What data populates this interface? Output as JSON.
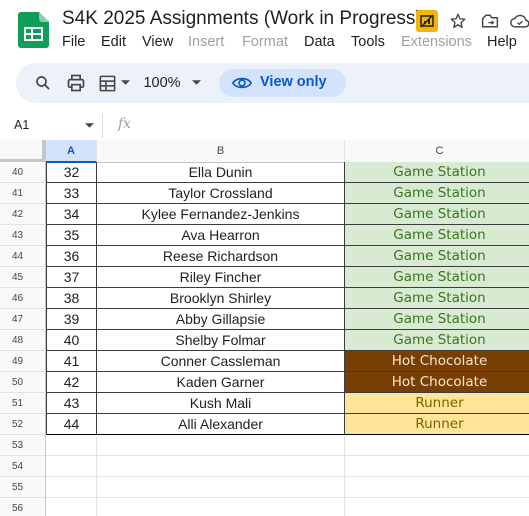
{
  "app": {
    "title": "S4K 2025 Assignments (Work in Progress)",
    "icons": [
      "sheets-logo-icon",
      "shared-drive-icon",
      "star-icon",
      "move-icon",
      "cloud-status-icon"
    ]
  },
  "menu": [
    "File",
    "Edit",
    "View",
    "Insert",
    "Format",
    "Data",
    "Tools",
    "Extensions",
    "Help"
  ],
  "menu_disabled": [
    "Insert",
    "Format",
    "Extensions"
  ],
  "toolbar": {
    "zoom": "100%",
    "view_only_label": "View only",
    "icons": [
      "search-icon",
      "print-icon",
      "format-menu-icon",
      "dropdown-icon",
      "eye-icon"
    ]
  },
  "formula_bar": {
    "name_box": "A1",
    "fx": "fx"
  },
  "columns": [
    "A",
    "B",
    "C"
  ],
  "selected_column": "A",
  "colors": {
    "game_station_bg": "#d9ead3",
    "game_station_text": "#38761d",
    "hot_chocolate_bg": "#783f04",
    "hot_chocolate_text": "#fce5cd",
    "runner_bg": "#ffe599",
    "runner_text": "#7f6000"
  },
  "rows": [
    {
      "row": "40",
      "num": "32",
      "name": "Ella Dunin",
      "role": "Game Station",
      "kind": "game"
    },
    {
      "row": "41",
      "num": "33",
      "name": "Taylor Crossland",
      "role": "Game Station",
      "kind": "game"
    },
    {
      "row": "42",
      "num": "34",
      "name": "Kylee Fernandez-Jenkins",
      "role": "Game Station",
      "kind": "game"
    },
    {
      "row": "43",
      "num": "35",
      "name": "Ava Hearron",
      "role": "Game Station",
      "kind": "game"
    },
    {
      "row": "44",
      "num": "36",
      "name": "Reese Richardson",
      "role": "Game Station",
      "kind": "game"
    },
    {
      "row": "45",
      "num": "37",
      "name": "Riley Fincher",
      "role": "Game Station",
      "kind": "game"
    },
    {
      "row": "46",
      "num": "38",
      "name": "Brooklyn Shirley",
      "role": "Game Station",
      "kind": "game"
    },
    {
      "row": "47",
      "num": "39",
      "name": "Abby Gillapsie",
      "role": "Game Station",
      "kind": "game"
    },
    {
      "row": "48",
      "num": "40",
      "name": "Shelby Folmar",
      "role": "Game Station",
      "kind": "game"
    },
    {
      "row": "49",
      "num": "41",
      "name": "Conner Cassleman",
      "role": "Hot Chocolate",
      "kind": "cocoa"
    },
    {
      "row": "50",
      "num": "42",
      "name": "Kaden Garner",
      "role": "Hot Chocolate",
      "kind": "cocoa"
    },
    {
      "row": "51",
      "num": "43",
      "name": "Kush Mali",
      "role": "Runner",
      "kind": "runner"
    },
    {
      "row": "52",
      "num": "44",
      "name": "Alli Alexander",
      "role": "Runner",
      "kind": "runner"
    },
    {
      "row": "53",
      "num": "",
      "name": "",
      "role": "",
      "kind": "empty"
    },
    {
      "row": "54",
      "num": "",
      "name": "",
      "role": "",
      "kind": "empty"
    },
    {
      "row": "55",
      "num": "",
      "name": "",
      "role": "",
      "kind": "empty"
    },
    {
      "row": "56",
      "num": "",
      "name": "",
      "role": "",
      "kind": "empty"
    }
  ]
}
